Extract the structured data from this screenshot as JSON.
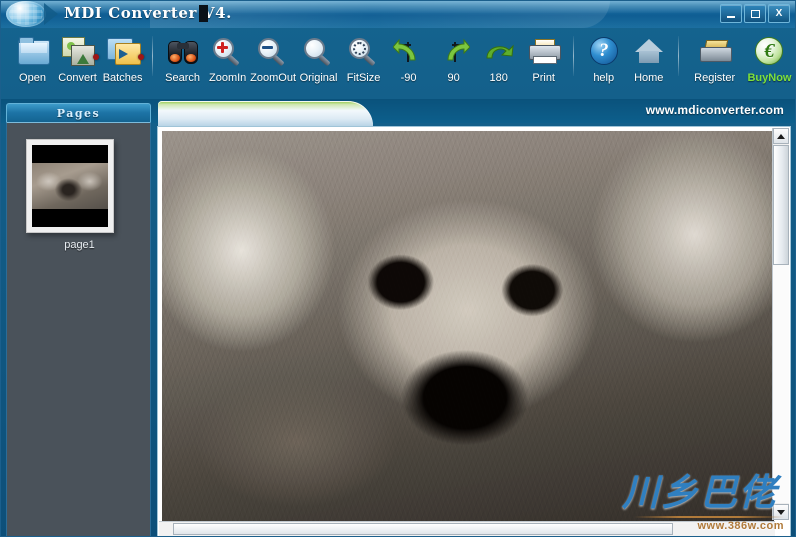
{
  "window": {
    "title": "MDI Converter V4.",
    "logo_icon": "globe-icon",
    "controls": {
      "minimize": "minimize-icon",
      "maximize": "maximize-icon",
      "close": "X"
    }
  },
  "toolbar": {
    "items": [
      {
        "label": "Open",
        "icon": "open-folder-icon"
      },
      {
        "label": "Convert",
        "icon": "convert-images-icon"
      },
      {
        "label": "Batches",
        "icon": "batch-folder-icon"
      },
      {
        "label": "Search",
        "icon": "binoculars-icon"
      },
      {
        "label": "ZoomIn",
        "icon": "magnifier-plus-icon"
      },
      {
        "label": "ZoomOut",
        "icon": "magnifier-minus-icon"
      },
      {
        "label": "Original",
        "icon": "magnifier-icon"
      },
      {
        "label": "FitSize",
        "icon": "magnifier-fit-icon"
      },
      {
        "label": "-90",
        "icon": "rotate-left-icon"
      },
      {
        "label": "90",
        "icon": "rotate-right-icon"
      },
      {
        "label": "180",
        "icon": "rotate-180-icon"
      },
      {
        "label": "Print",
        "icon": "printer-icon"
      },
      {
        "label": "help",
        "icon": "question-mark-icon"
      },
      {
        "label": "Home",
        "icon": "house-icon"
      },
      {
        "label": "Register",
        "icon": "cash-register-icon"
      },
      {
        "label": "BuyNow",
        "icon": "euro-coin-icon"
      }
    ]
  },
  "banner": {
    "site_url": "www.mdiconverter.com"
  },
  "sidebar": {
    "tab_label": "Pages",
    "pages": [
      {
        "label": "page1"
      }
    ]
  },
  "viewer": {
    "scrollbars": {
      "vertical_up": "scroll-up-arrow",
      "vertical_down": "scroll-down-arrow"
    }
  },
  "watermark": {
    "text": "川乡巴佬",
    "url": "www.386w.com"
  },
  "colors": {
    "title_blue": "#1f74a8",
    "toolbar_blue": "#0f6291",
    "sidebar_gray": "#4a525a",
    "buynow_green": "#7ee03a",
    "accent_light": "#63b2d8"
  }
}
